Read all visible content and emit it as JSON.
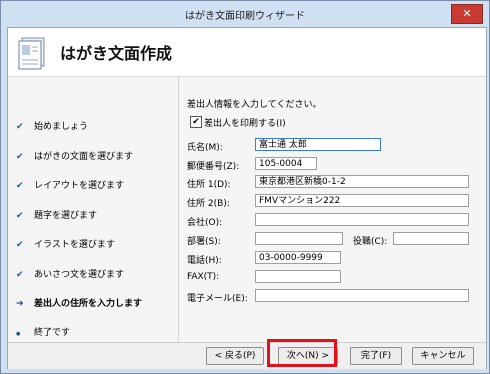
{
  "window": {
    "title": "はがき文面印刷ウィザード",
    "close": "✕"
  },
  "header": {
    "title": "はがき文面作成"
  },
  "steps": [
    {
      "label": "始めましょう",
      "mark": "✔"
    },
    {
      "label": "はがきの文面を選びます",
      "mark": "✔"
    },
    {
      "label": "レイアウトを選びます",
      "mark": "✔"
    },
    {
      "label": "題字を選びます",
      "mark": "✔"
    },
    {
      "label": "イラストを選びます",
      "mark": "✔"
    },
    {
      "label": "あいさつ文を選びます",
      "mark": "✔"
    },
    {
      "label": "差出人の住所を入力します",
      "mark": "➔"
    },
    {
      "label": "終了です",
      "mark": "●"
    }
  ],
  "form": {
    "instruction": "差出人情報を入力してください。",
    "print_sender": {
      "label": "差出人を印刷する(I)",
      "checked": true,
      "check": "✔"
    },
    "fields": {
      "name": {
        "label": "氏名(M):",
        "value": "富士通 太郎"
      },
      "postal": {
        "label": "郵便番号(Z):",
        "value": "105-0004"
      },
      "address1": {
        "label": "住所 1(D):",
        "value": "東京都港区新橋0-1-2"
      },
      "address2": {
        "label": "住所 2(B):",
        "value": "FMVマンション222"
      },
      "company": {
        "label": "会社(O):",
        "value": ""
      },
      "department": {
        "label": "部署(S):",
        "value": ""
      },
      "position": {
        "label": "役職(C):",
        "value": ""
      },
      "phone": {
        "label": "電話(H):",
        "value": "03-0000-9999"
      },
      "fax": {
        "label": "FAX(T):",
        "value": ""
      },
      "email": {
        "label": "電子メール(E):",
        "value": ""
      }
    }
  },
  "footer": {
    "back": "< 戻る(P)",
    "next": "次へ(N) >",
    "finish": "完了(F)",
    "cancel": "キャンセル"
  },
  "colors": {
    "highlight": "#e0101c",
    "accent": "#1f5aa8"
  }
}
